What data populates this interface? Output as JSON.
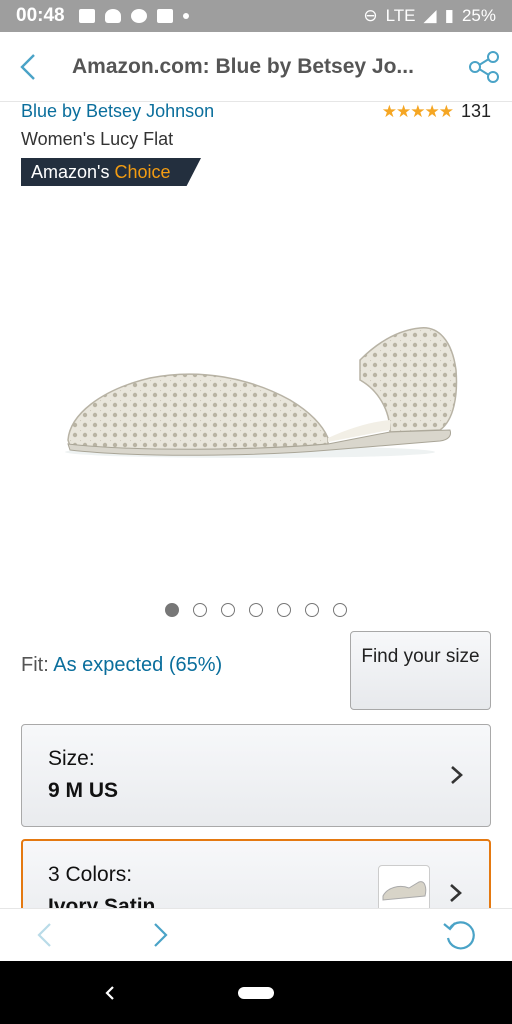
{
  "status_bar": {
    "time": "00:48",
    "network": "LTE",
    "battery": "25%"
  },
  "header": {
    "title": "Amazon.com: Blue by Betsey Jo...",
    "icons": {
      "back": "chevron-left-icon",
      "share": "share-icon"
    }
  },
  "product": {
    "brand": "Blue by Betsey Johnson",
    "name": "Women's Lucy Flat",
    "rating_stars": 4.5,
    "rating_display": "★★★★★",
    "rating_count": "131",
    "badge": {
      "prefix": "Amazon's",
      "highlight": "Choice"
    }
  },
  "carousel": {
    "total": 7,
    "active_index": 0
  },
  "fit": {
    "label": "Fit:",
    "value": "As expected (65%)",
    "button": "Find your size"
  },
  "size": {
    "label": "Size:",
    "value": "9 M US"
  },
  "colors": {
    "label": "3 Colors:",
    "value": "Ivory Satin"
  },
  "colors_theme": {
    "link": "#0a6e9c",
    "accent": "#e47911",
    "badge_bg": "#232f3e",
    "badge_highlight": "#f39c12",
    "star": "#f5a623",
    "nav_icon": "#4aa3c7"
  }
}
